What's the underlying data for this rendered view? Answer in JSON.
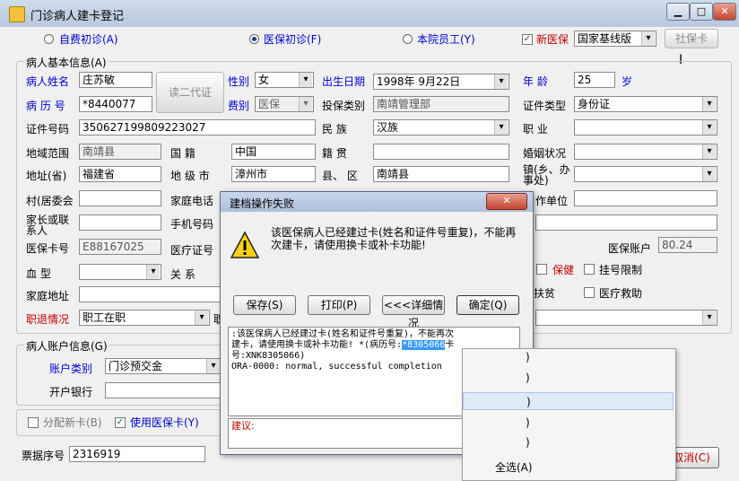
{
  "window": {
    "title": "门诊病人建卡登记",
    "min": "▁",
    "max": "□",
    "close": "✕"
  },
  "top_row": {
    "radio_self_pay": "自费初诊(A)",
    "radio_insurance": "医保初诊(F)",
    "radio_staff": "本院员工(Y)",
    "check_new_insurance": "新医保",
    "insurance_type": "国家基线版",
    "social_card_btn": "社保卡"
  },
  "basic_info": {
    "group_title": "病人基本信息(A)",
    "read_id_btn": "读二代证",
    "labels": {
      "name": "病人姓名",
      "record_no": "病 历 号",
      "id_no": "证件号码",
      "region": "地域范围",
      "address_province": "地址(省)",
      "village": "村(居委会",
      "guardian": "家长或联系人",
      "insurance_card": "医保卡号",
      "blood": "血    型",
      "home_address": "家庭地址",
      "status": "职退情况",
      "gender": "性别",
      "fee_type": "费别",
      "birth": "出生日期",
      "insure_category": "投保类别",
      "ethnicity": "民      族",
      "nationality": "国      籍",
      "native_place": "籍      贯",
      "city": "地 级 市",
      "county": "县、 区",
      "home_phone": "家庭电话",
      "mobile": "手机号码",
      "cert_no_lbl": "医疗证号",
      "relation": "关      系",
      "age": "年      龄",
      "age_unit": "岁",
      "id_type": "证件类型",
      "occupation": "职      业",
      "marital": "婚姻状况",
      "town": "镇(乡、办事处)",
      "work_unit": "作单位",
      "account": "医保账户",
      "guarantee": "保健",
      "reg_limit": "挂号限制",
      "poverty": "扶贫",
      "medical_aid": "医疗救助",
      "status_extra": "职"
    },
    "values": {
      "name": "庄苏敏",
      "record_no": "*8440077",
      "id_no": "350627199809223027",
      "region": "南靖县",
      "address_province": "福建省",
      "insurance_card": "E88167025",
      "status": "职工在职",
      "gender": "女",
      "fee_type": "医保",
      "birth": "1998年 9月22日",
      "insure_category": "南靖管理部",
      "ethnicity": "汉族",
      "nationality": "中国",
      "city": "漳州市",
      "county": "南靖县",
      "age": "25",
      "id_type": "身份证",
      "account": "80.24"
    }
  },
  "account_info": {
    "group_title": "病人账户信息(G)",
    "account_type_lbl": "账户类别",
    "account_type": "门诊预交金",
    "bank_lbl": "开户银行"
  },
  "bottom": {
    "assign_card": "分配新卡(B)",
    "use_insurance_card": "使用医保卡(Y)",
    "receipt_lbl": "票据序号",
    "receipt_no": "2316919",
    "cancel_btn": "取消(C)"
  },
  "dialog": {
    "title": "建档操作失败",
    "close": "✕",
    "message": "该医保病人已经建过卡(姓名和证件号重复)，不能再次建卡，请使用换卡或补卡功能!",
    "btn_save": "保存(S)",
    "btn_print": "打印(P)",
    "btn_details": "<<<详细情况",
    "btn_ok": "确定(Q)",
    "detail_line1": ":该医保病人已经建过卡(姓名和证件号重复)，不能再次",
    "detail_line2a": "建卡，请使用换卡或补卡功能! *(病历号:",
    "detail_highlight": "*8305066",
    "detail_line2b": "卡",
    "detail_line3": "号:XNK8305066)",
    "detail_line4": "ORA-0000: normal, successful completion",
    "suggest_lbl": "建议:"
  },
  "context_menu": {
    "items": [
      ")",
      ")",
      ")",
      ")",
      "全选(A)"
    ]
  }
}
